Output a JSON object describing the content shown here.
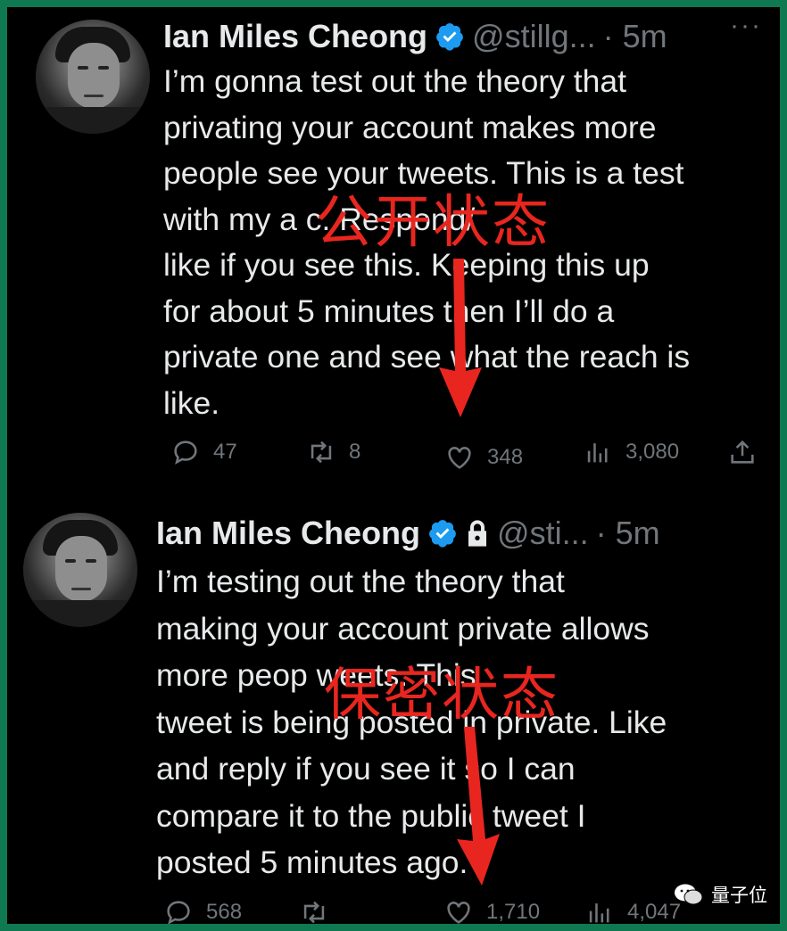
{
  "tweets": [
    {
      "name": "Ian Miles Cheong",
      "handle": "@stillg...",
      "time": "· 5m",
      "more": "···",
      "text": "I’m gonna test out the theory that\nprivating your account makes more\npeople see your tweets. This is a test\nwith my a                         c. Respond/\nlike if you see this. Keeping this up\nfor about 5 minutes then I’ll do a\nprivate one and see what the reach is\nlike.",
      "replies": "47",
      "retweets": "8",
      "likes": "348",
      "views": "3,080",
      "overlay_label": "公开状态",
      "locked": false
    },
    {
      "name": "Ian Miles Cheong",
      "handle": "@sti...",
      "time": "· 5m",
      "more": "",
      "text": "I’m testing out the theory that\nmaking your account private allows\nmore peop                          weets. This\ntweet is being posted in private. Like\nand reply if you see it so I can\ncompare it to the public tweet I\nposted 5 minutes ago.",
      "replies": "568",
      "retweets": "",
      "likes": "1,710",
      "views": "4,047",
      "overlay_label": "保密状态",
      "locked": true
    }
  ],
  "icons": {
    "reply": "reply-icon",
    "retweet": "retweet-icon",
    "like": "heart-icon",
    "views": "views-icon",
    "share": "share-icon",
    "verified": "verified-badge-icon",
    "lock": "lock-icon"
  },
  "colors": {
    "background": "#000000",
    "border": "#0f7a52",
    "text": "#e7e9ea",
    "muted": "#71767b",
    "verified": "#1d9bf0",
    "annotation": "#e8261f"
  },
  "watermark": "量子位"
}
